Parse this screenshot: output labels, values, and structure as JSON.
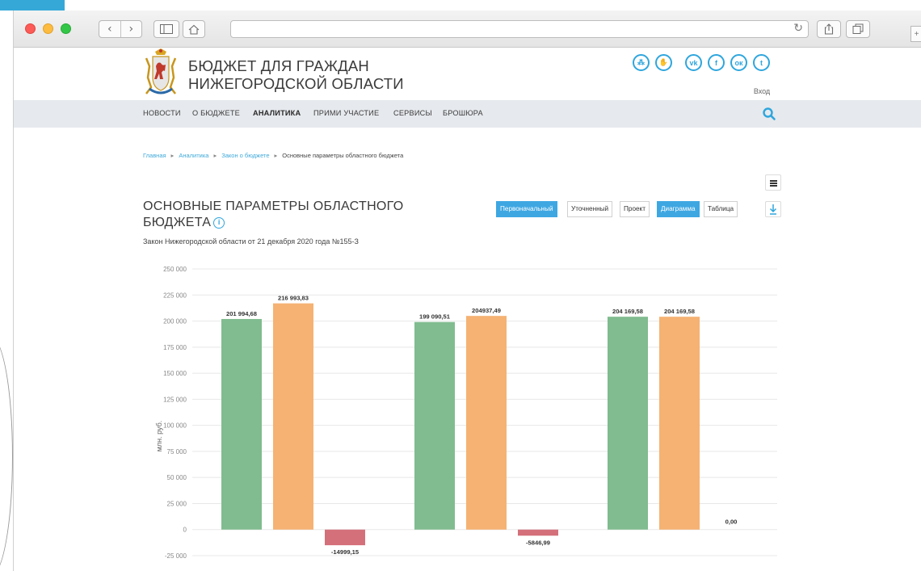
{
  "browser": {
    "url": ""
  },
  "site": {
    "title_line1": "БЮДЖЕТ ДЛЯ ГРАЖДАН",
    "title_line2": "НИЖЕГОРОДСКОЙ ОБЛАСТИ",
    "login_label": "Вход",
    "social_icons": [
      "hierarchy-icon",
      "handshake-icon",
      "vk-icon",
      "facebook-icon",
      "odnoklassniki-icon",
      "twitter-icon"
    ],
    "social_glyphs": [
      "⁂",
      "✋",
      "vk",
      "f",
      "ок",
      "t"
    ]
  },
  "menu": {
    "items": [
      "НОВОСТИ",
      "О БЮДЖЕТЕ",
      "АНАЛИТИКА",
      "ПРИМИ УЧАСТИЕ",
      "СЕРВИСЫ",
      "БРОШЮРА"
    ],
    "active": "АНАЛИТИКА"
  },
  "breadcrumb": {
    "items": [
      "Главная",
      "Аналитика",
      "Закон о бюджете"
    ],
    "current": "Основные параметры областного бюджета"
  },
  "page": {
    "title": "ОСНОВНЫЕ ПАРАМЕТРЫ ОБЛАСТНОГО БЮДЖЕТА",
    "subtitle": "Закон Нижегородской области от 21 декабря 2020 года №155-З"
  },
  "tabs": {
    "version": [
      "Первоначальный",
      "Уточненный",
      "Проект"
    ],
    "version_selected": "Первоначальный",
    "view": [
      "Диаграмма",
      "Таблица"
    ],
    "view_selected": "Диаграмма"
  },
  "colors": {
    "accent": "#3ea7e2",
    "green": "#80bc8f",
    "orange": "#f5b273",
    "red": "#d4707a"
  },
  "chart_data": {
    "type": "bar",
    "ylabel": "млн. руб.",
    "ylim": [
      -25000,
      250000
    ],
    "yticks": [
      "250 000",
      "225 000",
      "200 000",
      "175 000",
      "150 000",
      "125 000",
      "100 000",
      "75 000",
      "50 000",
      "25 000",
      "0",
      "-25 000"
    ],
    "ytick_values": [
      250000,
      225000,
      200000,
      175000,
      150000,
      125000,
      100000,
      75000,
      50000,
      25000,
      0,
      -25000
    ],
    "groups": [
      {
        "bars": [
          {
            "value": 201994.68,
            "label": "201 994,68",
            "color": "green"
          },
          {
            "value": 216993.83,
            "label": "216 993,83",
            "color": "orange"
          },
          {
            "value": -14999.15,
            "label": "-14999,15",
            "color": "red"
          }
        ]
      },
      {
        "bars": [
          {
            "value": 199090.51,
            "label": "199 090,51",
            "color": "green"
          },
          {
            "value": 204937.49,
            "label": "204937,49",
            "color": "orange"
          },
          {
            "value": -5846.99,
            "label": "-5846,99",
            "color": "red"
          }
        ]
      },
      {
        "bars": [
          {
            "value": 204169.58,
            "label": "204 169,58",
            "color": "green"
          },
          {
            "value": 204169.58,
            "label": "204 169,58",
            "color": "orange"
          },
          {
            "value": 0,
            "label": "0,00",
            "color": "red"
          }
        ]
      }
    ]
  }
}
